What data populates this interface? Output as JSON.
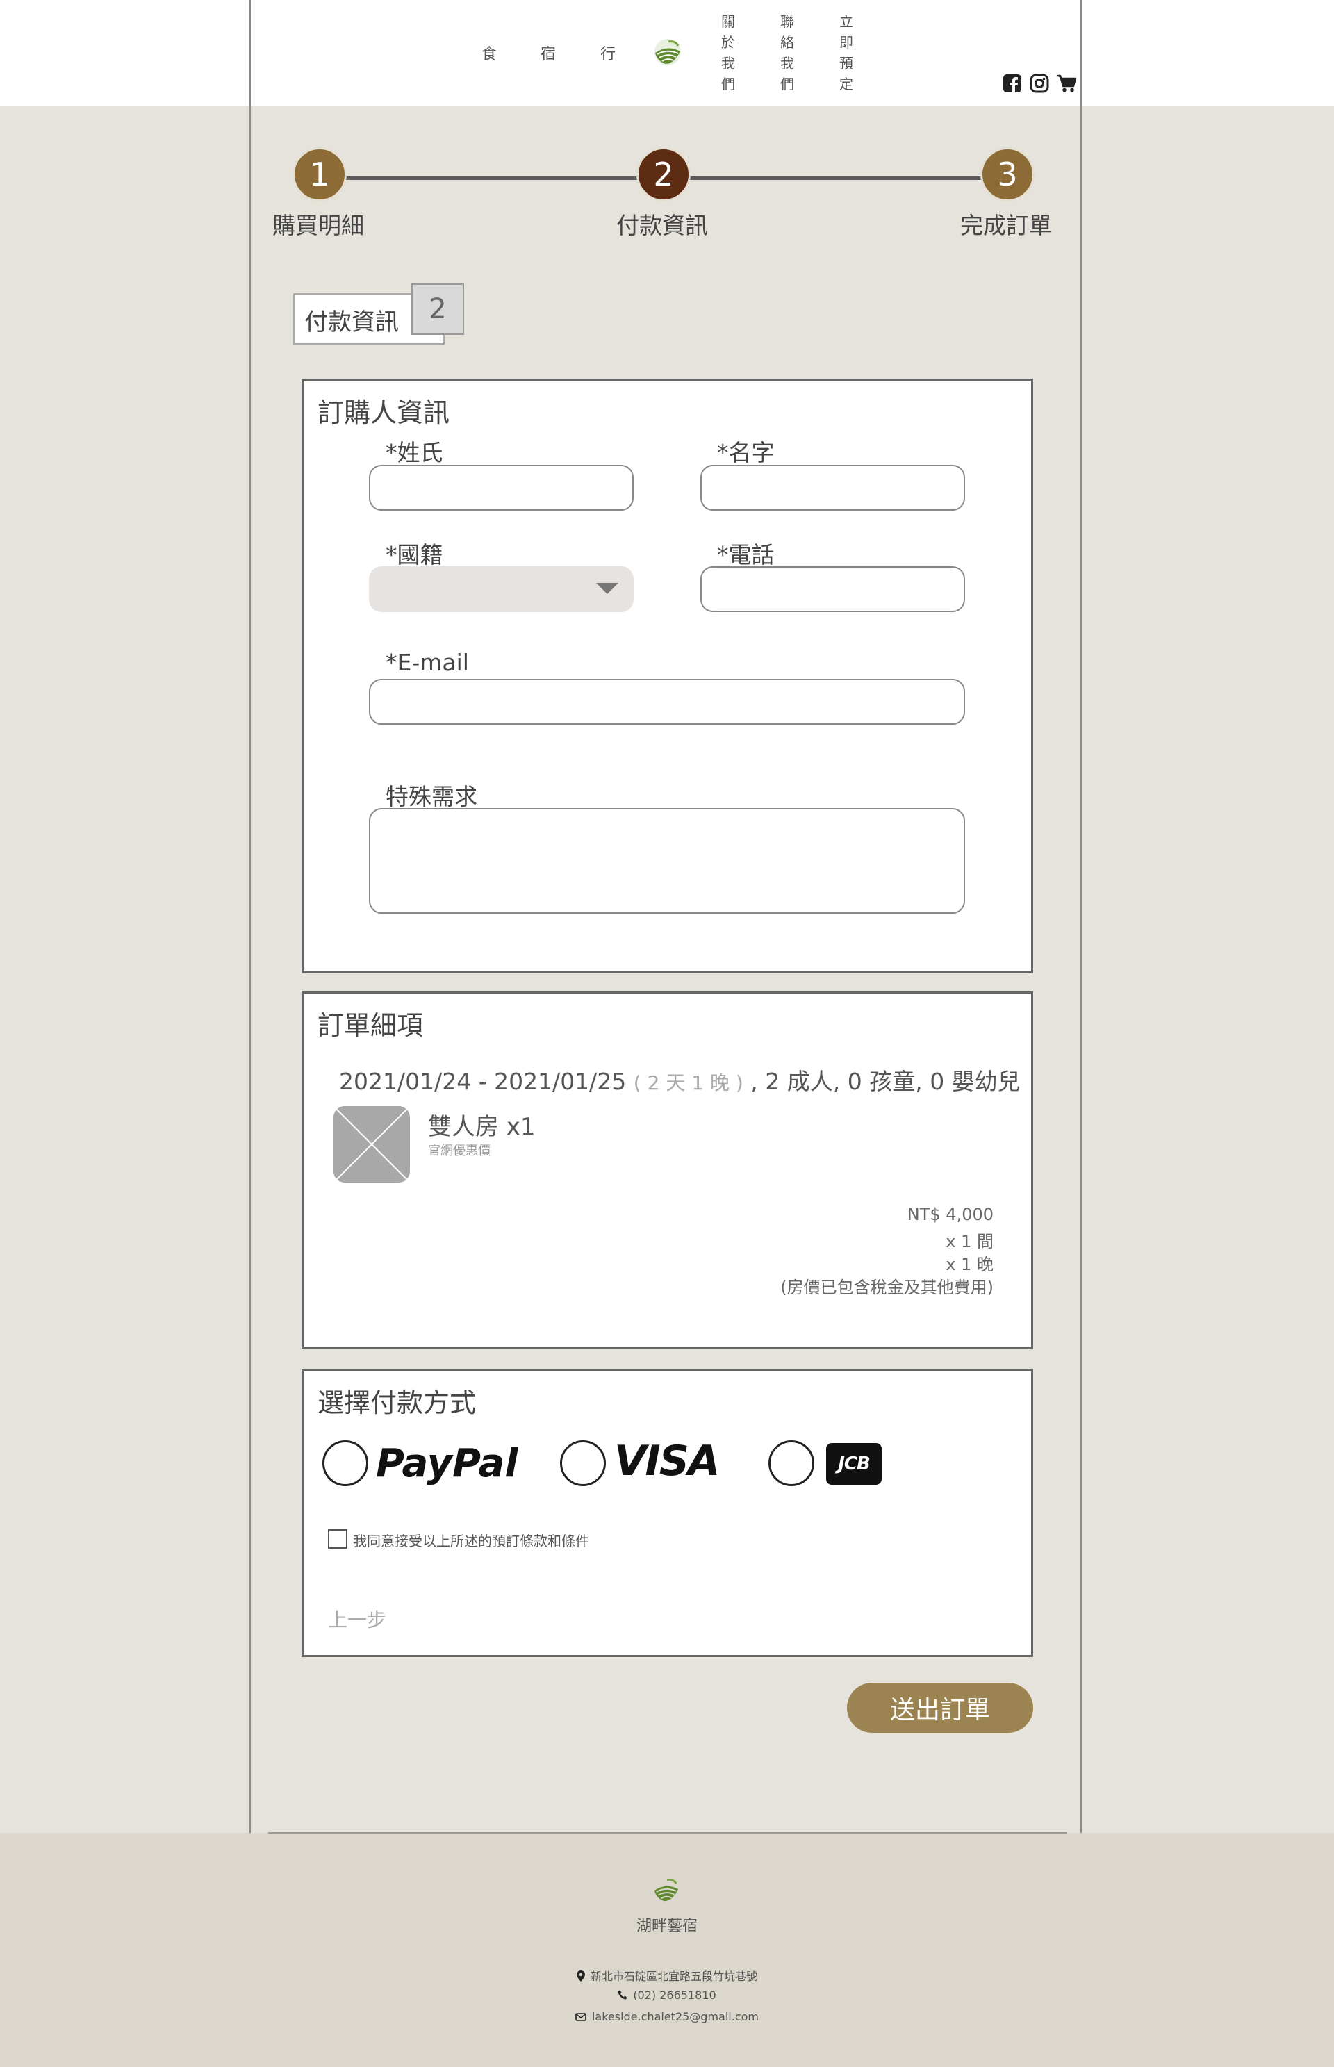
{
  "nav": {
    "food": "食",
    "stay": "宿",
    "travel": "行",
    "about": [
      "關",
      "於",
      "我",
      "們"
    ],
    "contact": [
      "聯",
      "絡",
      "我",
      "們"
    ],
    "book": [
      "立",
      "即",
      "預",
      "定"
    ]
  },
  "icons": {
    "facebook": "facebook-icon",
    "instagram": "instagram-icon",
    "cart": "cart-icon"
  },
  "steps": [
    {
      "number": "1",
      "label": "購買明細",
      "color": "#8c6b37"
    },
    {
      "number": "2",
      "label": "付款資訊",
      "color": "#5e2c12"
    },
    {
      "number": "3",
      "label": "完成訂單",
      "color": "#8c6b37"
    }
  ],
  "tab": {
    "label": "付款資訊",
    "number": "2"
  },
  "buyer": {
    "title": "訂購人資訊",
    "last_name_label": "*姓氏",
    "last_name_value": "",
    "first_name_label": "*名字",
    "first_name_value": "",
    "nationality_label": "*國籍",
    "nationality_value": "",
    "phone_label": "*電話",
    "phone_value": "",
    "email_label": "*E-mail",
    "email_value": "",
    "special_label": "特殊需求",
    "special_value": ""
  },
  "order": {
    "title": "訂單細項",
    "dates": "2021/01/24 - 2021/01/25",
    "nights": "( 2 天 1 晚 )",
    "guests": ", 2 成人, 0 孩童, 0 嬰幼兒",
    "room_name": "雙人房 x1",
    "rate_name": "官網優惠價",
    "price": "NT$ 4,000",
    "rooms": "x 1 間",
    "night_count": "x 1 晚",
    "tax_note": "(房價已包含稅金及其他費用)"
  },
  "payment": {
    "title": "選擇付款方式",
    "paypal": "PayPal",
    "visa": "VISA",
    "jcb": "JCB",
    "agree": "我同意接受以上所述的預訂條款和條件",
    "prev": "上一步"
  },
  "submit_label": "送出訂單",
  "footer": {
    "name": "湖畔藝宿",
    "address": "新北市石碇區北宜路五段竹坑巷號",
    "phone": "(02) 26651810",
    "email": "lakeside.chalet25@gmail.com"
  },
  "colors": {
    "accent": "#9b8352",
    "active_step": "#5e2c12",
    "step": "#8c6b37"
  }
}
